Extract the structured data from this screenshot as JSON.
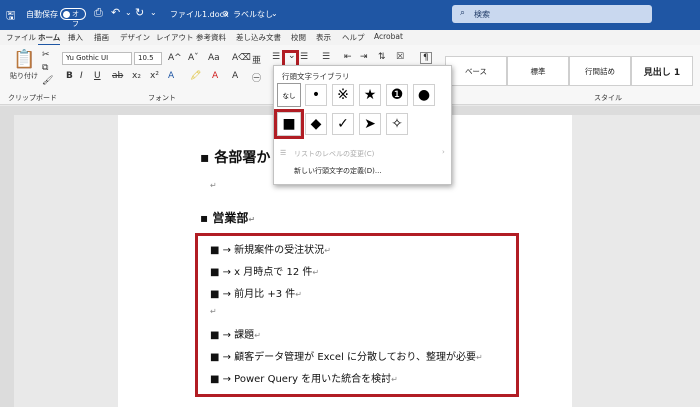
{
  "titlebar": {
    "autosave_label": "自動保存",
    "autosave_state": "オフ",
    "filename": "ファイル1.docx",
    "sensitivity": "ラベルなし",
    "search_label": "検索"
  },
  "menu": {
    "items": [
      "ファイル",
      "ホーム",
      "挿入",
      "描画",
      "デザイン",
      "レイアウト",
      "参考資料",
      "差し込み文書",
      "校閲",
      "表示",
      "ヘルプ",
      "Acrobat"
    ],
    "active": "ホーム"
  },
  "ribbon": {
    "paste_label": "貼り付け",
    "clipboard_group": "クリップボード",
    "font_group": "フォント",
    "style_group": "スタイル",
    "font_name": "Yu Gothic UI",
    "font_size": "10.5",
    "styles": [
      "ベース",
      "標準",
      "行間詰め",
      "見出し 1"
    ]
  },
  "bullet_library": {
    "title": "行頭文字ライブラリ",
    "none_label": "なし",
    "symbols_row1": [
      "•",
      "※",
      "★",
      "❶",
      "●"
    ],
    "symbols_row2": [
      "■",
      "◆",
      "✓",
      "➤",
      "✧"
    ],
    "change_level": "リストのレベルの変更(C)",
    "define_new": "新しい行頭文字の定義(D)..."
  },
  "document": {
    "heading1": "各部署か",
    "heading2": "営業部",
    "list_items": [
      "■ → 新規案件の受注状況",
      "■ → x 月時点で 12 件",
      "■ → 前月比 +3 件",
      "■ → 課題",
      "■ → 顧客データ管理が Excel に分散しており、整理が必要",
      "■ → Power Query を用いた統合を検討"
    ]
  },
  "accent_colors": {
    "title_bar": "#1f56a4",
    "highlight_border": "#b11d24"
  }
}
